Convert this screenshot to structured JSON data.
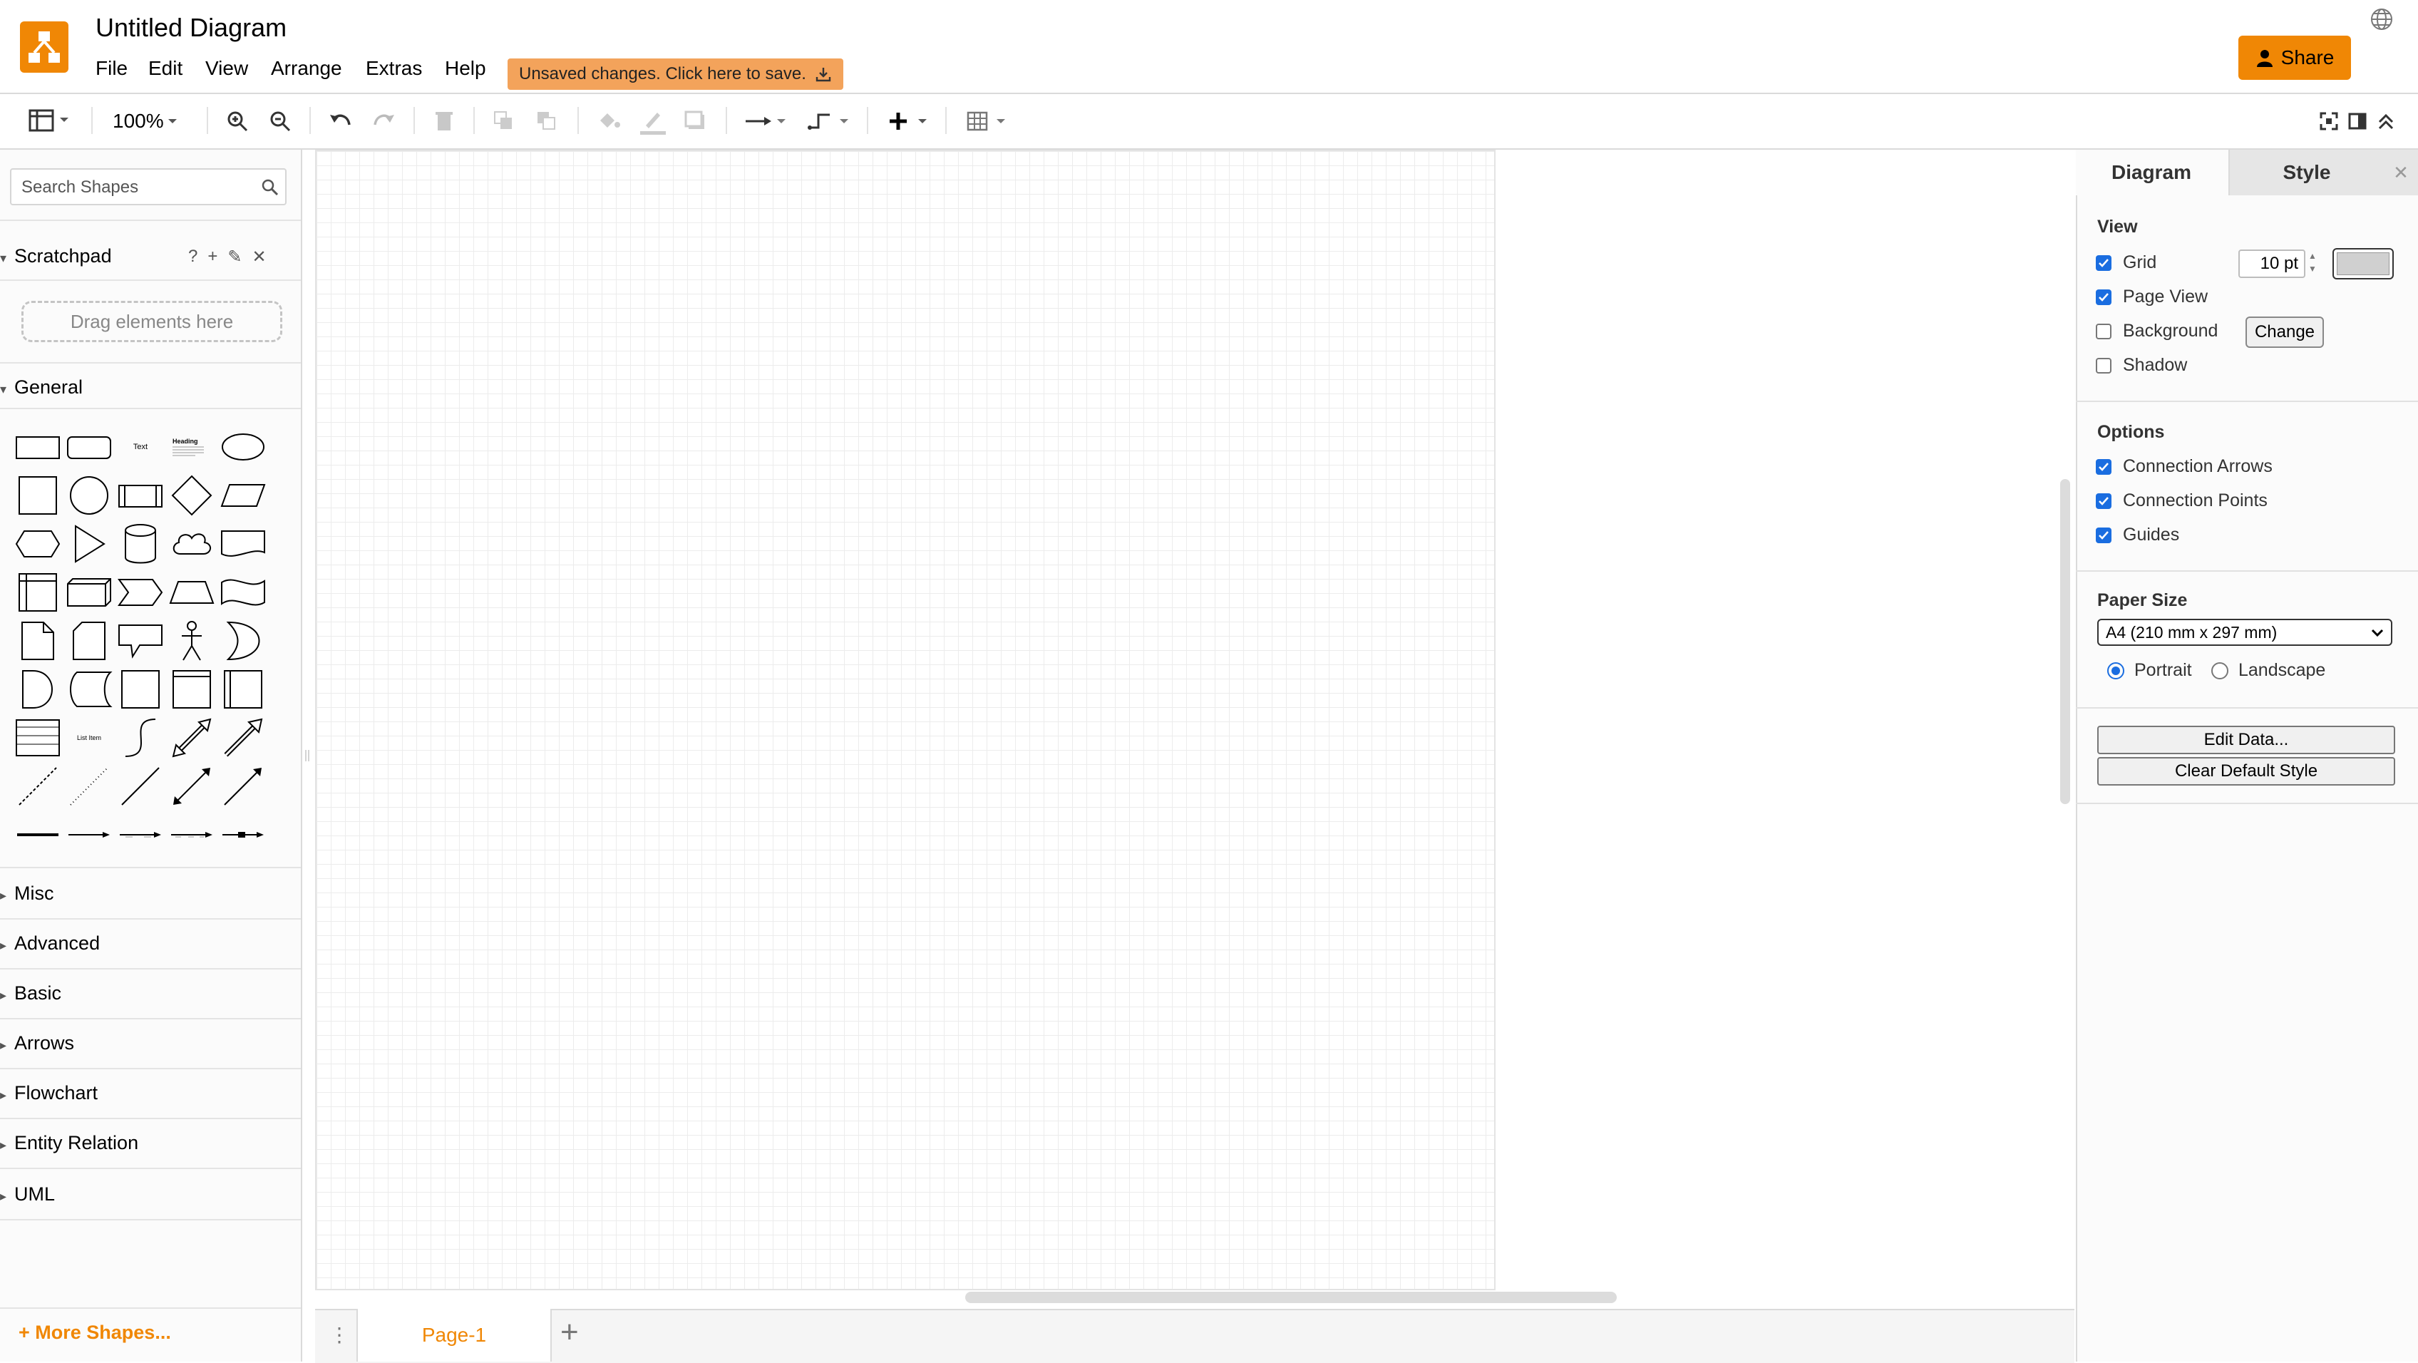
{
  "header": {
    "title": "Untitled Diagram",
    "menu": [
      "File",
      "Edit",
      "View",
      "Arrange",
      "Extras",
      "Help"
    ],
    "save_banner": "Unsaved changes. Click here to save.",
    "share_label": "Share",
    "brand_color": "#f08705"
  },
  "toolbar": {
    "zoom": "100%",
    "icons": [
      "format-panel-icon",
      "zoom-in-icon",
      "zoom-out-icon",
      "undo-icon",
      "redo-icon",
      "delete-icon",
      "to-front-icon",
      "to-back-icon",
      "fill-color-icon",
      "line-color-icon",
      "shadow-icon",
      "connection-icon",
      "waypoints-icon",
      "insert-icon",
      "table-icon",
      "fullscreen-icon",
      "toggle-format-icon",
      "collapse-icon"
    ]
  },
  "sidebar": {
    "search_placeholder": "Search Shapes",
    "scratchpad": {
      "title": "Scratchpad",
      "drop_hint": "Drag elements here"
    },
    "general": {
      "title": "General",
      "text_label": "Text",
      "heading_label": "Heading",
      "list_item_label": "List Item"
    },
    "sections": [
      "Misc",
      "Advanced",
      "Basic",
      "Arrows",
      "Flowchart",
      "Entity Relation",
      "UML"
    ],
    "more_shapes": "+ More Shapes..."
  },
  "pages": {
    "tabs": [
      "Page-1"
    ]
  },
  "format_panel": {
    "tabs": [
      "Diagram",
      "Style"
    ],
    "view": {
      "title": "View",
      "grid": {
        "label": "Grid",
        "checked": true,
        "size": "10 pt"
      },
      "page_view": {
        "label": "Page View",
        "checked": true
      },
      "background": {
        "label": "Background",
        "checked": false,
        "button": "Change"
      },
      "shadow": {
        "label": "Shadow",
        "checked": false
      }
    },
    "options": {
      "title": "Options",
      "connection_arrows": {
        "label": "Connection Arrows",
        "checked": true
      },
      "connection_points": {
        "label": "Connection Points",
        "checked": true
      },
      "guides": {
        "label": "Guides",
        "checked": true
      }
    },
    "paper": {
      "title": "Paper Size",
      "size": "A4 (210 mm x 297 mm)",
      "portrait": "Portrait",
      "landscape": "Landscape",
      "orientation": "Portrait"
    },
    "edit_data": "Edit Data...",
    "clear_default_style": "Clear Default Style"
  }
}
